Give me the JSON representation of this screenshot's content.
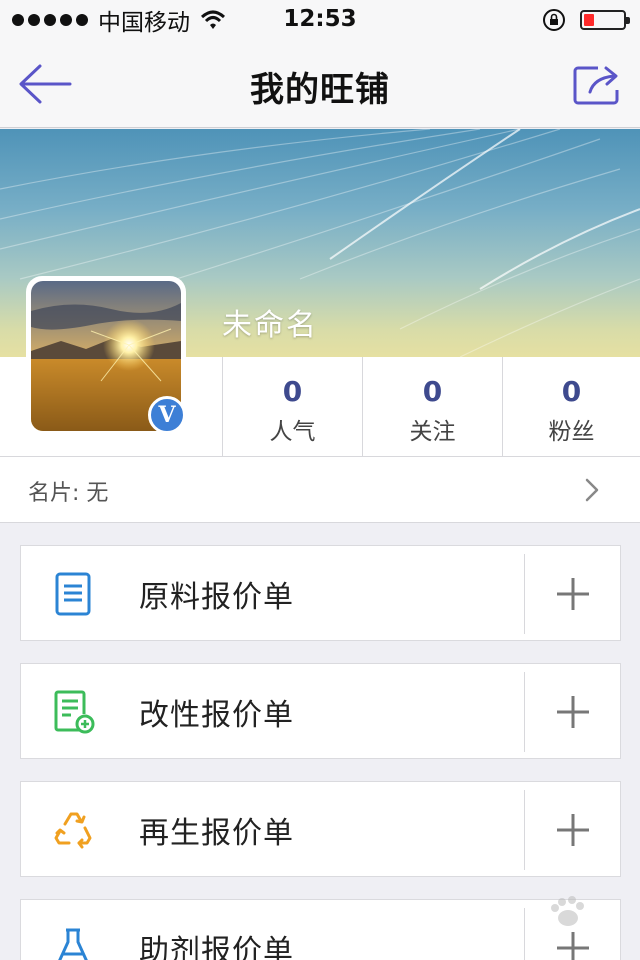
{
  "status_bar": {
    "carrier": "中国移动",
    "time": "12:53"
  },
  "nav": {
    "title": "我的旺铺"
  },
  "profile": {
    "shop_name": "未命名",
    "verified_badge": "V",
    "stats": [
      {
        "value": "0",
        "label": "人气"
      },
      {
        "value": "0",
        "label": "关注"
      },
      {
        "value": "0",
        "label": "粉丝"
      }
    ]
  },
  "business_card": {
    "label": "名片: 无"
  },
  "quotes": [
    {
      "label": "原料报价单",
      "icon": "document-icon",
      "color": "#2b84d4"
    },
    {
      "label": "改性报价单",
      "icon": "document-add-icon",
      "color": "#3cbc5a"
    },
    {
      "label": "再生报价单",
      "icon": "recycle-icon",
      "color": "#f0a020"
    },
    {
      "label": "助剂报价单",
      "icon": "flask-icon",
      "color": "#2b84d4"
    }
  ],
  "colors": {
    "accent": "#5a55c8",
    "stat_number": "#3e4a8e"
  }
}
